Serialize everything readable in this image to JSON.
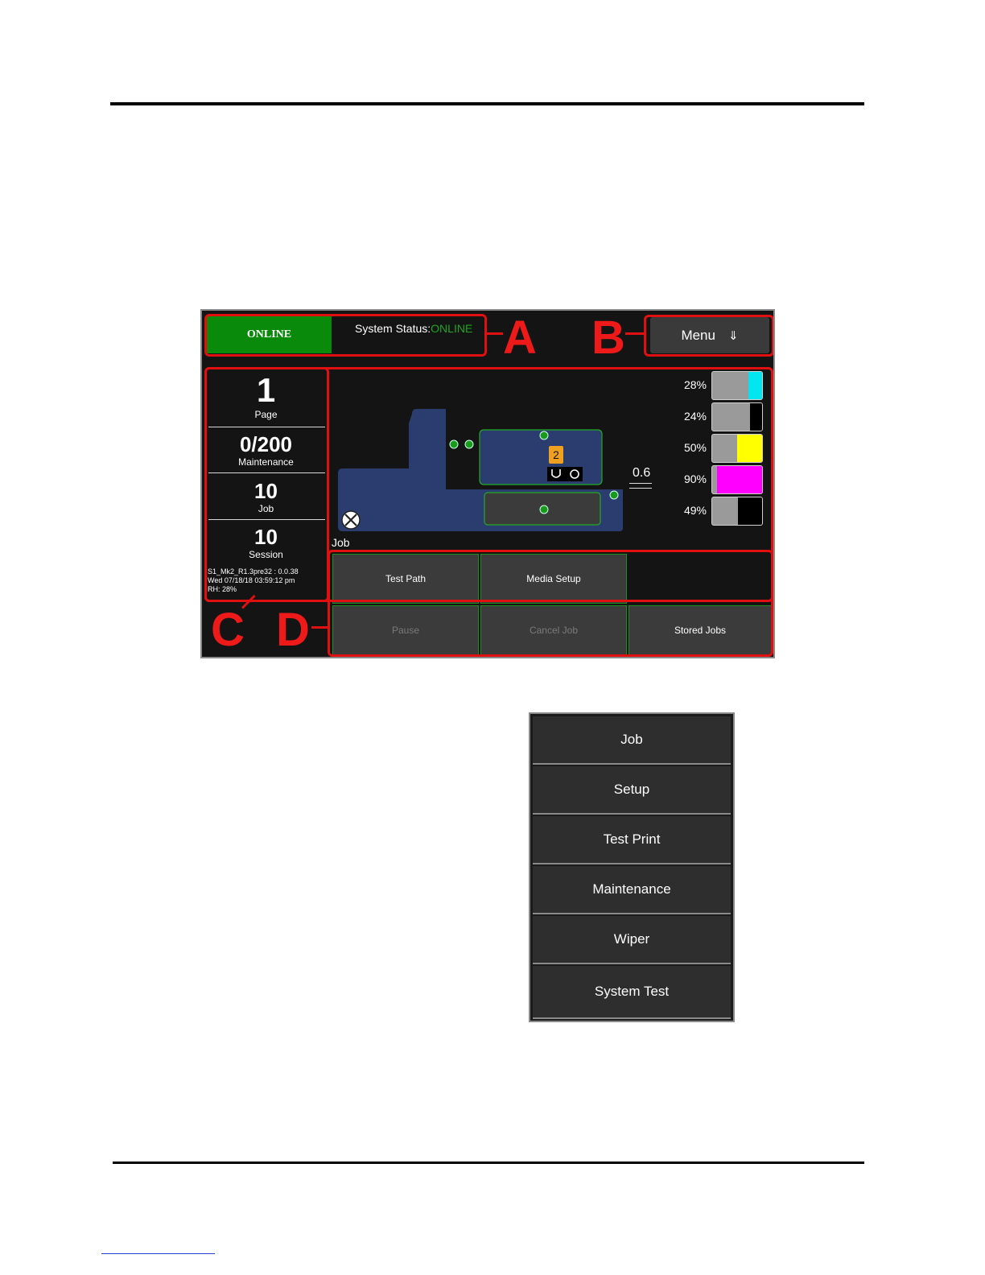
{
  "main_ui": {
    "online_indicator": "ONLINE",
    "system_status_label": "System Status:",
    "system_status_value": "ONLINE",
    "menu_button": {
      "label": "Menu",
      "arrow": "⇓"
    },
    "callouts": [
      "A",
      "B",
      "C",
      "D"
    ],
    "counters": [
      {
        "value": "1",
        "label": "Page"
      },
      {
        "value": "0/200",
        "label": "Maintenance"
      },
      {
        "value": "10",
        "label": "Job"
      },
      {
        "value": "10",
        "label": "Session"
      }
    ],
    "info_lines": [
      "S1_Mk2_R1.3pre32 : 0.0.38",
      "Wed 07/18/18 03:59:12 pm",
      "RH: 28%"
    ],
    "machine": {
      "print_position_badge": "2",
      "speed_value": "0.6",
      "job_label": "Job",
      "status_dot_color": "#1a9a1a",
      "badge_color": "#f0a020"
    },
    "ink_levels": [
      {
        "percent": "28%",
        "level": 0.28,
        "color": "#00e5ee"
      },
      {
        "percent": "24%",
        "level": 0.24,
        "color": "#000000"
      },
      {
        "percent": "50%",
        "level": 0.5,
        "color": "#ffff00"
      },
      {
        "percent": "90%",
        "level": 0.9,
        "color": "#ff00ff"
      },
      {
        "percent": "49%",
        "level": 0.49,
        "color": "#000000"
      }
    ],
    "buttons": {
      "test_path": "Test Path",
      "media_setup": "Media Setup",
      "pause": "Pause",
      "cancel_job": "Cancel Job",
      "stored_jobs": "Stored Jobs"
    }
  },
  "menu_dropdown": {
    "items": [
      "Job",
      "Setup",
      "Test Print",
      "Maintenance",
      "Wiper",
      "System Test"
    ]
  },
  "colors": {
    "online_green": "#0a8a0a",
    "callout_red": "#e01010",
    "panel_background": "#141414",
    "machine_blue": "#2b3d6e"
  }
}
